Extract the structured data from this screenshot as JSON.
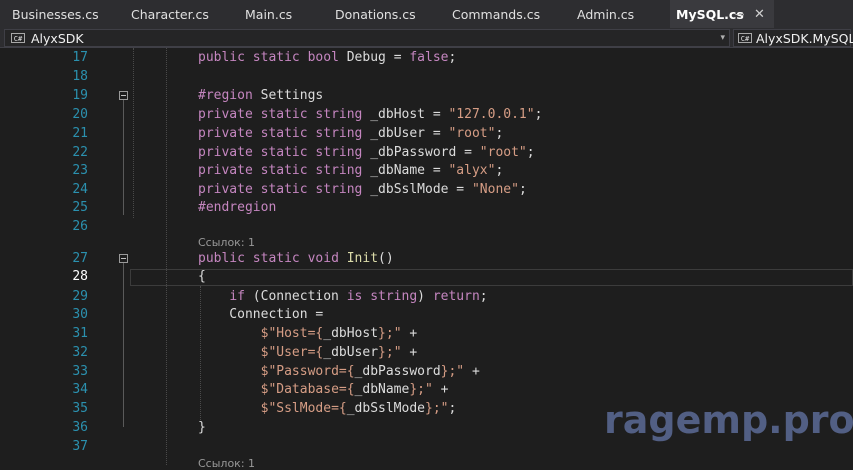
{
  "tabs": [
    {
      "label": "Businesses.cs",
      "active": false
    },
    {
      "label": "Character.cs",
      "active": false
    },
    {
      "label": "Main.cs",
      "active": false
    },
    {
      "label": "Donations.cs",
      "active": false
    },
    {
      "label": "Commands.cs",
      "active": false
    },
    {
      "label": "Admin.cs",
      "active": false
    },
    {
      "label": "MySQL.cs",
      "active": true
    }
  ],
  "tab_icons": {
    "pin": "pin-icon",
    "close": "close-icon",
    "pin_glyph": "⊸",
    "close_glyph": "✕"
  },
  "navbar": {
    "project": "AlyxSDK",
    "type": "AlyxSDK.MySQL",
    "cs_glyph": "C#",
    "dropdown_glyph": "▾"
  },
  "editor": {
    "current_line": 28,
    "codelens": [
      "Ссылок: 1",
      "Ссылок: 1"
    ],
    "lines": [
      {
        "no": "17",
        "tokens": [
          [
            "kw",
            "public"
          ],
          [
            "pl",
            " "
          ],
          [
            "kw",
            "static"
          ],
          [
            "pl",
            " "
          ],
          [
            "kw",
            "bool"
          ],
          [
            "pl",
            " Debug = "
          ],
          [
            "kw",
            "false"
          ],
          [
            "pl",
            ";"
          ]
        ]
      },
      {
        "no": "18",
        "tokens": []
      },
      {
        "no": "19",
        "tokens": [
          [
            "kw",
            "#region"
          ],
          [
            "pl",
            " Settings"
          ]
        ]
      },
      {
        "no": "20",
        "tokens": [
          [
            "kw",
            "private"
          ],
          [
            "pl",
            " "
          ],
          [
            "kw",
            "static"
          ],
          [
            "pl",
            " "
          ],
          [
            "kw",
            "string"
          ],
          [
            "pl",
            " _dbHost = "
          ],
          [
            "str",
            "\"127.0.0.1\""
          ],
          [
            "pl",
            ";"
          ]
        ]
      },
      {
        "no": "21",
        "tokens": [
          [
            "kw",
            "private"
          ],
          [
            "pl",
            " "
          ],
          [
            "kw",
            "static"
          ],
          [
            "pl",
            " "
          ],
          [
            "kw",
            "string"
          ],
          [
            "pl",
            " _dbUser = "
          ],
          [
            "str",
            "\"root\""
          ],
          [
            "pl",
            ";"
          ]
        ]
      },
      {
        "no": "22",
        "tokens": [
          [
            "kw",
            "private"
          ],
          [
            "pl",
            " "
          ],
          [
            "kw",
            "static"
          ],
          [
            "pl",
            " "
          ],
          [
            "kw",
            "string"
          ],
          [
            "pl",
            " _dbPassword = "
          ],
          [
            "str",
            "\"root\""
          ],
          [
            "pl",
            ";"
          ]
        ]
      },
      {
        "no": "23",
        "tokens": [
          [
            "kw",
            "private"
          ],
          [
            "pl",
            " "
          ],
          [
            "kw",
            "static"
          ],
          [
            "pl",
            " "
          ],
          [
            "kw",
            "string"
          ],
          [
            "pl",
            " _dbName = "
          ],
          [
            "str",
            "\"alyx\""
          ],
          [
            "pl",
            ";"
          ]
        ]
      },
      {
        "no": "24",
        "tokens": [
          [
            "kw",
            "private"
          ],
          [
            "pl",
            " "
          ],
          [
            "kw",
            "static"
          ],
          [
            "pl",
            " "
          ],
          [
            "kw",
            "string"
          ],
          [
            "pl",
            " _dbSslMode = "
          ],
          [
            "str",
            "\"None\""
          ],
          [
            "pl",
            ";"
          ]
        ]
      },
      {
        "no": "25",
        "tokens": [
          [
            "kw",
            "#endregion"
          ]
        ]
      },
      {
        "no": "26",
        "tokens": []
      },
      {
        "no": "27",
        "tokens": [
          [
            "kw",
            "public"
          ],
          [
            "pl",
            " "
          ],
          [
            "kw",
            "static"
          ],
          [
            "pl",
            " "
          ],
          [
            "kw",
            "void"
          ],
          [
            "pl",
            " "
          ],
          [
            "fn",
            "Init"
          ],
          [
            "pl",
            "()"
          ]
        ]
      },
      {
        "no": "28",
        "tokens": [
          [
            "pl",
            "{"
          ]
        ]
      },
      {
        "no": "29",
        "tokens": [
          [
            "pl",
            "    "
          ],
          [
            "kw",
            "if"
          ],
          [
            "pl",
            " (Connection "
          ],
          [
            "kw",
            "is"
          ],
          [
            "pl",
            " "
          ],
          [
            "kw",
            "string"
          ],
          [
            "pl",
            ") "
          ],
          [
            "kw",
            "return"
          ],
          [
            "pl",
            ";"
          ]
        ]
      },
      {
        "no": "30",
        "tokens": [
          [
            "pl",
            "    Connection ="
          ]
        ]
      },
      {
        "no": "31",
        "tokens": [
          [
            "pl",
            "        "
          ],
          [
            "str",
            "$\"Host={"
          ],
          [
            "pl",
            "_dbHost"
          ],
          [
            "str",
            "};\""
          ],
          [
            "pl",
            " +"
          ]
        ]
      },
      {
        "no": "32",
        "tokens": [
          [
            "pl",
            "        "
          ],
          [
            "str",
            "$\"User={"
          ],
          [
            "pl",
            "_dbUser"
          ],
          [
            "str",
            "};\""
          ],
          [
            "pl",
            " +"
          ]
        ]
      },
      {
        "no": "33",
        "tokens": [
          [
            "pl",
            "        "
          ],
          [
            "str",
            "$\"Password={"
          ],
          [
            "pl",
            "_dbPassword"
          ],
          [
            "str",
            "};\""
          ],
          [
            "pl",
            " +"
          ]
        ]
      },
      {
        "no": "34",
        "tokens": [
          [
            "pl",
            "        "
          ],
          [
            "str",
            "$\"Database={"
          ],
          [
            "pl",
            "_dbName"
          ],
          [
            "str",
            "};\""
          ],
          [
            "pl",
            " +"
          ]
        ]
      },
      {
        "no": "35",
        "tokens": [
          [
            "pl",
            "        "
          ],
          [
            "str",
            "$\"SslMode={"
          ],
          [
            "pl",
            "_dbSslMode"
          ],
          [
            "str",
            "};\""
          ],
          [
            "pl",
            ";"
          ]
        ]
      },
      {
        "no": "36",
        "tokens": [
          [
            "pl",
            "}"
          ]
        ]
      },
      {
        "no": "37",
        "tokens": []
      }
    ]
  },
  "watermark": "ragemp.pro",
  "colors": {
    "background": "#1e1e1e",
    "keyword": "#c586c0",
    "string": "#d69d85",
    "method": "#dcdcaa",
    "line_number": "#2b91af"
  }
}
